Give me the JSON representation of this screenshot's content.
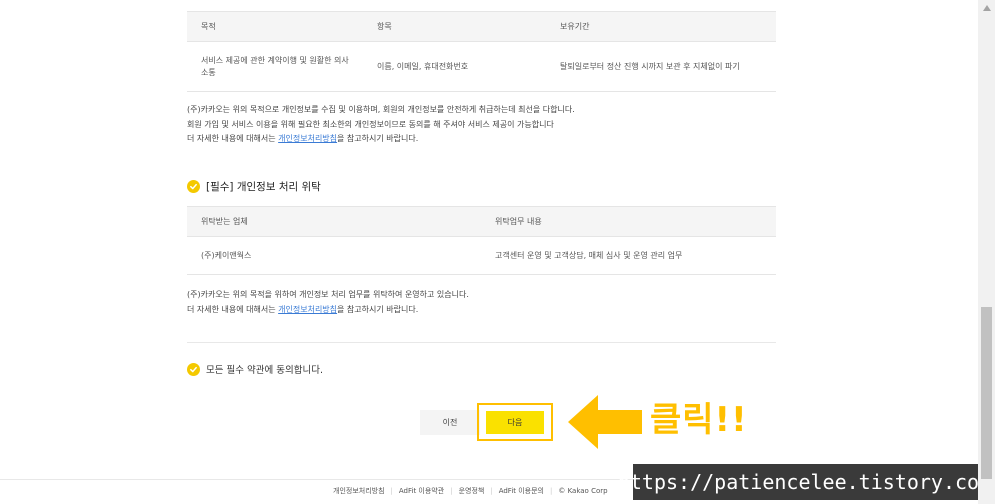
{
  "table1": {
    "headers": [
      "목적",
      "항목",
      "보유기간"
    ],
    "row": [
      "서비스 제공에 관한 계약이행 및 원활한 의사소통",
      "이름, 이메일, 휴대전화번호",
      "탈퇴일로부터 정산 진행 시까지 보관 후 지체없이 파기"
    ]
  },
  "note1": {
    "line1": "(주)카카오는 위의 목적으로 개인정보를 수집 및 이용하며, 회원의 개인정보를 안전하게 취급하는데 최선을 다합니다.",
    "line2": "회원 가입 및 서비스 이용을 위해 필요한 최소한의 개인정보이므로 동의를 해 주셔야 서비스 제공이 가능합니다",
    "line3_prefix": "더 자세한 내용에 대해서는 ",
    "link": "개인정보처리방침",
    "line3_suffix": "을 참고하시기 바랍니다."
  },
  "section2": {
    "title": "[필수] 개인정보 처리 위탁"
  },
  "table2": {
    "headers": [
      "위탁받는 업체",
      "위탁업무 내용"
    ],
    "row": [
      "(주)케이앤웍스",
      "고객센터 운영 및 고객상담, 매체 심사 및 운영 관리 업무"
    ]
  },
  "note2": {
    "line1": "(주)카카오는 위의 목적을 위하여 개인정보 처리 업무를 위탁하여 운영하고 있습니다.",
    "line2_prefix": "더 자세한 내용에 대해서는 ",
    "link": "개인정보처리방침",
    "line2_suffix": "을 참고하시기 바랍니다."
  },
  "agree_all": "모든 필수 약관에 동의합니다.",
  "buttons": {
    "prev": "이전",
    "next": "다음"
  },
  "annotation": {
    "text": "클릭!!"
  },
  "footer": {
    "links": [
      "개인정보처리방침",
      "AdFit 이용약관",
      "운영정책",
      "AdFit 이용문의"
    ],
    "copyright": "© Kakao Corp"
  },
  "watermark": "https://patiencelee.tistory.com/",
  "colors": {
    "accent": "#fae100",
    "check": "#f4c900",
    "annotation": "#ffbf00",
    "link": "#3a7bd5"
  }
}
